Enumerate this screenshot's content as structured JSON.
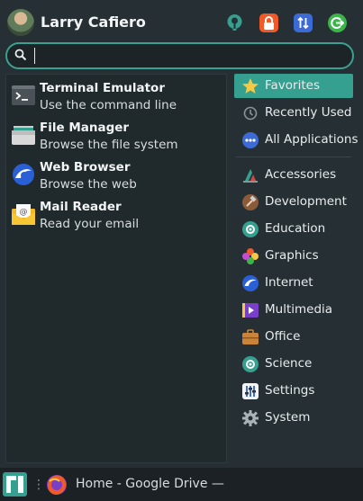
{
  "user": {
    "name": "Larry Cafiero"
  },
  "header_buttons": [
    {
      "name": "software-icon",
      "color": "#35a08f"
    },
    {
      "name": "lock-icon",
      "color": "#f05a28"
    },
    {
      "name": "switch-user-icon",
      "color": "#3d6bd6"
    },
    {
      "name": "logout-icon",
      "color": "#3bb54a"
    }
  ],
  "search": {
    "value": "",
    "placeholder": ""
  },
  "apps": [
    {
      "name": "Terminal Emulator",
      "description": "Use the command line",
      "icon": "terminal-icon"
    },
    {
      "name": "File Manager",
      "description": "Browse the file system",
      "icon": "folder-icon"
    },
    {
      "name": "Web Browser",
      "description": "Browse the web",
      "icon": "web-browser-icon"
    },
    {
      "name": "Mail Reader",
      "description": "Read your email",
      "icon": "mail-icon"
    }
  ],
  "categories": [
    {
      "label": "Favorites",
      "icon": "star-icon",
      "selected": true
    },
    {
      "label": "Recently Used",
      "icon": "clock-icon"
    },
    {
      "label": "All Applications",
      "icon": "dots-icon"
    },
    {
      "label": "Accessories",
      "icon": "accessories-icon"
    },
    {
      "label": "Development",
      "icon": "hammer-icon"
    },
    {
      "label": "Education",
      "icon": "education-icon"
    },
    {
      "label": "Graphics",
      "icon": "graphics-icon"
    },
    {
      "label": "Internet",
      "icon": "globe-icon"
    },
    {
      "label": "Multimedia",
      "icon": "multimedia-icon"
    },
    {
      "label": "Office",
      "icon": "briefcase-icon"
    },
    {
      "label": "Science",
      "icon": "science-icon"
    },
    {
      "label": "Settings",
      "icon": "settings-icon"
    },
    {
      "label": "System",
      "icon": "gear-icon"
    }
  ],
  "taskbar": {
    "window_title": "Home - Google Drive —",
    "handle": "⋮",
    "window_icon": "firefox-icon"
  },
  "colors": {
    "accent": "#35a08f",
    "background": "#263034",
    "panel": "#202a2d"
  }
}
